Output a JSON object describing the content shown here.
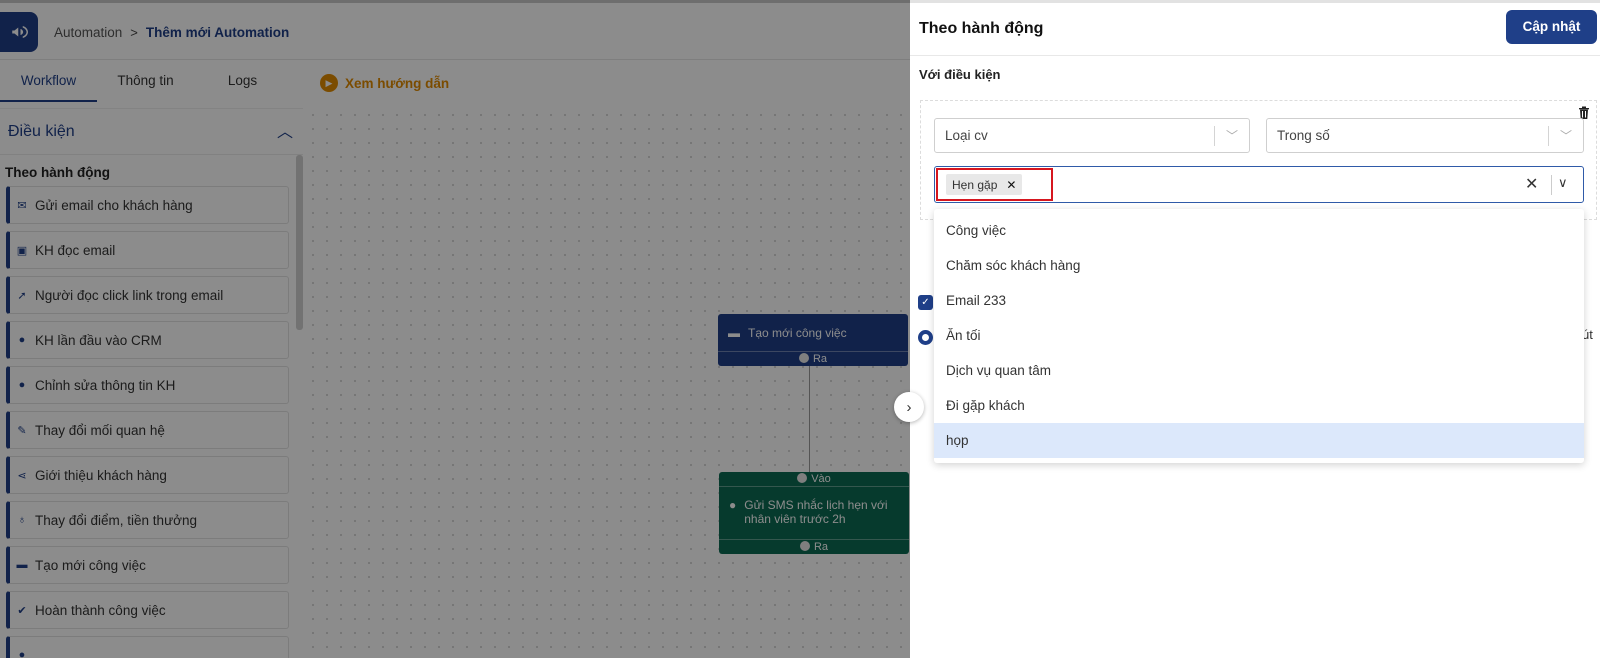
{
  "header": {
    "breadcrumb": [
      "Automation",
      "Thêm mới Automation"
    ],
    "separator": ">"
  },
  "tabs": [
    {
      "label": "Workflow",
      "active": true
    },
    {
      "label": "Thông tin",
      "active": false
    },
    {
      "label": "Logs",
      "active": false
    }
  ],
  "guide_label": "Xem hướng dẫn",
  "palette": {
    "title": "Điều kiện",
    "section": "Theo hành động",
    "items": [
      {
        "label": "Gửi email cho khách hàng",
        "icon": "mail-icon"
      },
      {
        "label": "KH đọc email",
        "icon": "inbox-icon"
      },
      {
        "label": "Người đọc click link trong email",
        "icon": "cursor-click-icon"
      },
      {
        "label": "KH lần đầu vào CRM",
        "icon": "user-icon"
      },
      {
        "label": "Chỉnh sửa thông tin KH",
        "icon": "user-icon"
      },
      {
        "label": "Thay đổi mối quan hệ",
        "icon": "pencil-icon"
      },
      {
        "label": "Giới thiệu khách hàng",
        "icon": "share-icon"
      },
      {
        "label": "Thay đổi điểm, tiền thưởng",
        "icon": "money-bag-icon"
      },
      {
        "label": "Tạo mới công việc",
        "icon": "briefcase-icon"
      },
      {
        "label": "Hoàn thành công việc",
        "icon": "check-circle-icon"
      }
    ]
  },
  "canvas": {
    "node1": {
      "label": "Tạo mới công việc",
      "out_port": "Ra"
    },
    "node2": {
      "label": "Gửi SMS nhắc lịch hẹn với nhân viên trước 2h",
      "in_port": "Vào",
      "out_port": "Ra"
    }
  },
  "drawer": {
    "title": "Theo hành động",
    "update_button": "Cập nhật",
    "condition_label": "Với điều kiện",
    "type_select": "Loại cv",
    "operator_select": "Trong số",
    "selected_tag": "Hẹn gặp",
    "partial_text": "út",
    "options": [
      {
        "label": "Công việc",
        "highlighted": false
      },
      {
        "label": "Chăm sóc khách hàng",
        "highlighted": false
      },
      {
        "label": "Email 233",
        "highlighted": false
      },
      {
        "label": "Ăn tối",
        "highlighted": false
      },
      {
        "label": "Dịch vụ quan tâm",
        "highlighted": false
      },
      {
        "label": "Đi gặp khách",
        "highlighted": false
      },
      {
        "label": "họp",
        "highlighted": true
      }
    ]
  },
  "colors": {
    "primary": "#1f3f88",
    "node_green": "#0b6a52",
    "accent_orange": "#e08a00",
    "highlight_red": "#d6161f"
  }
}
